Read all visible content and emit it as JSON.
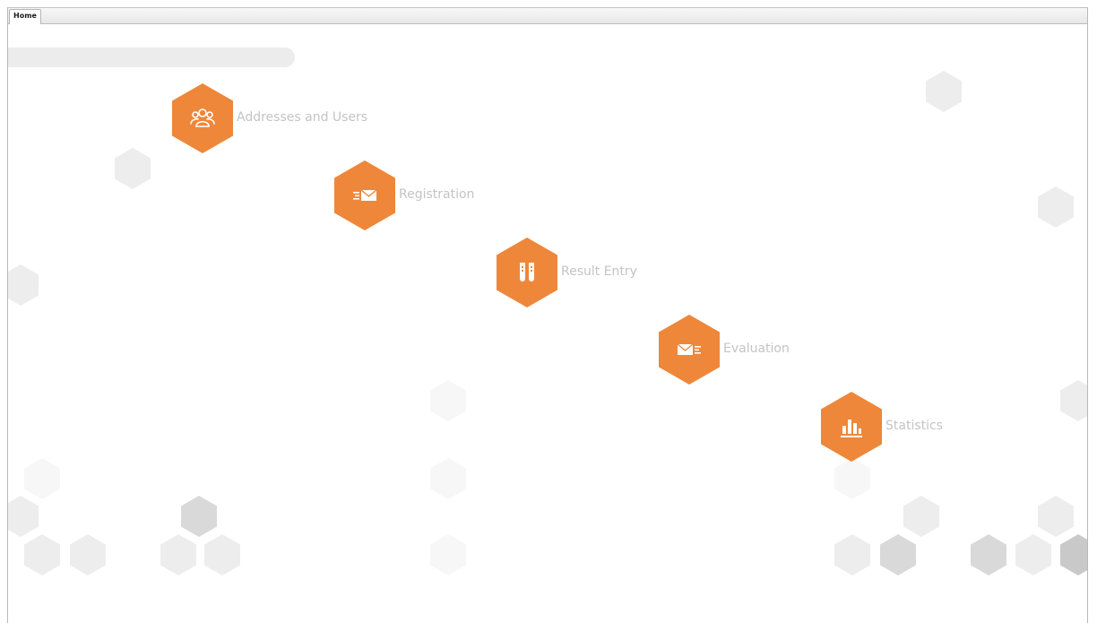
{
  "tabs": [
    {
      "label": "Home",
      "active": true
    }
  ],
  "menu": {
    "accent_color": "#ee873a",
    "items": [
      {
        "label": "Addresses and Users",
        "icon": "users-icon"
      },
      {
        "label": "Registration",
        "icon": "envelope-fast-icon"
      },
      {
        "label": "Result Entry",
        "icon": "test-tubes-icon"
      },
      {
        "label": "Evaluation",
        "icon": "envelope-list-icon"
      },
      {
        "label": "Statistics",
        "icon": "bar-chart-icon"
      }
    ]
  }
}
